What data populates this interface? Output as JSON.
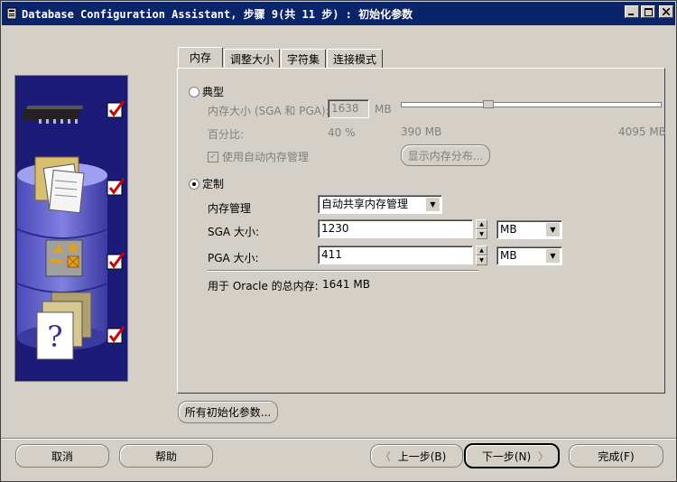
{
  "window": {
    "title": "Database Configuration Assistant, 步骤 9(共 11 步) : 初始化参数",
    "minimize_label": "_",
    "maximize_label": "□",
    "close_label": "X"
  },
  "tabs": [
    {
      "label": "内存"
    },
    {
      "label": "调整大小"
    },
    {
      "label": "字符集"
    },
    {
      "label": "连接模式"
    }
  ],
  "typical": {
    "radio_label": "典型",
    "memory_size_label": "内存大小 (SGA 和 PGA):",
    "memory_size_value": "1638",
    "memory_size_unit": "MB",
    "slider_min": "390 MB",
    "slider_max": "4095 MB",
    "slider_level_fraction": 0.33,
    "percent_label": "百分比:",
    "percent_value": "40 %",
    "auto_memory_label": "使用自动内存管理",
    "show_memory_button": "显示内存分布..."
  },
  "custom": {
    "radio_label": "定制",
    "memory_management_label": "内存管理",
    "memory_management_value": "自动共享内存管理",
    "sga_label": "SGA 大小:",
    "sga_value": "1230",
    "sga_unit": "MB",
    "pga_label": "PGA 大小:",
    "pga_value": "411",
    "pga_unit": "MB",
    "total_label": "用于 Oracle 的总内存:",
    "total_value": "1641 MB"
  },
  "all_params_button": "所有初始化参数...",
  "footer": {
    "cancel": "取消",
    "help": "帮助",
    "back": "上一步(B)",
    "next": "下一步(N)",
    "finish": "完成(F)"
  }
}
